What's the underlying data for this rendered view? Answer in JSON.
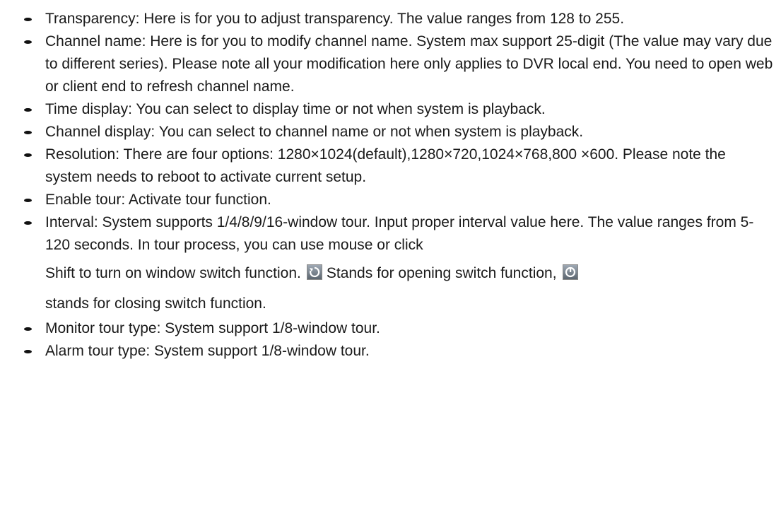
{
  "items": [
    {
      "text": "Transparency: Here is for you to adjust transparency. The value ranges from 128 to 255."
    },
    {
      "text": "Channel name: Here is for you to modify channel name. System max support 25-digit (The value may vary due to different series). Please note all your modification here only applies to DVR local end. You need to open web or client end to refresh channel name."
    },
    {
      "text": "Time display: You can select to display time or not when system is playback."
    },
    {
      "text": "Channel display: You can select to channel name or not when system is playback."
    },
    {
      "text": "Resolution: There are four options: 1280×1024(default),1280×720,1024×768,800 ×600. Please note the system needs to reboot to activate current setup."
    },
    {
      "text": "Enable tour: Activate tour function."
    },
    {
      "line1": "Interval: System supports 1/4/8/9/16-window tour. Input proper interval value here.",
      "line2": "The value ranges from 5-120 seconds. In tour process, you can use mouse or click",
      "line3a": "Shift to turn on window switch function.",
      "icon_open": "switch-open-icon",
      "line3b": "Stands for opening switch function,",
      "icon_close": "switch-close-icon",
      "line4": "stands for closing switch function."
    },
    {
      "text": "Monitor tour type: System support 1/8-window tour."
    },
    {
      "text": "Alarm tour type: System support 1/8-window tour."
    }
  ]
}
